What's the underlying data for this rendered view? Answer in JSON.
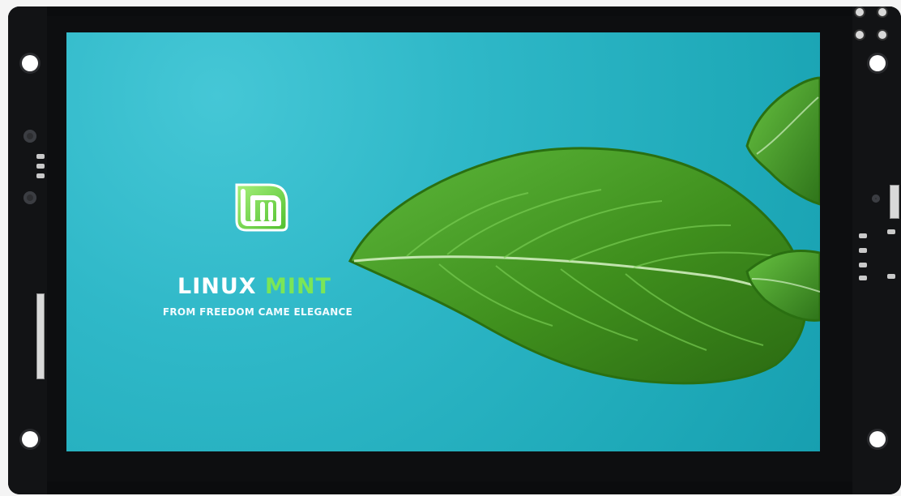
{
  "desktop": {
    "brand": {
      "name_part1": "LINUX",
      "name_part2": "MINT",
      "slogan": "FROM FREEDOM CAME ELEGANCE",
      "logo_glyph": "lm"
    },
    "colors": {
      "background": "#2fb8c8",
      "mint_green": "#7be657",
      "leaf_green": "#3f8f1d"
    },
    "icons": {
      "logo": "linux-mint-logo-icon",
      "leaf": "mint-leaf-icon"
    }
  }
}
